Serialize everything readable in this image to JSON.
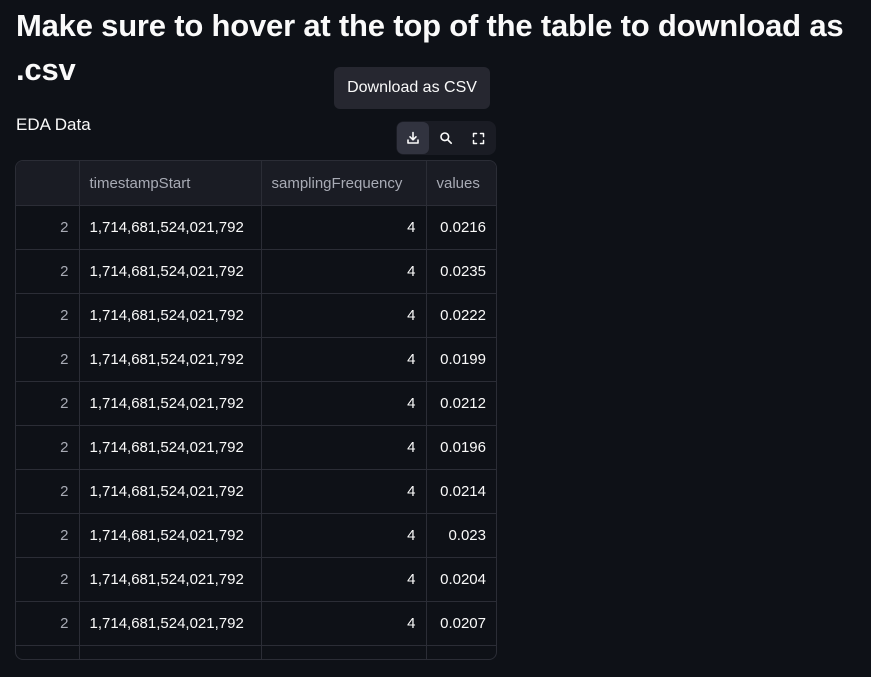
{
  "page": {
    "title": "Make sure to hover at the top of the table to download as .csv",
    "tooltip": "Download as CSV",
    "section_label": "EDA Data"
  },
  "toolbar": {
    "buttons": [
      {
        "icon": "download-icon"
      },
      {
        "icon": "search-icon"
      },
      {
        "icon": "fullscreen-icon"
      }
    ]
  },
  "table": {
    "columns": [
      "",
      "timestampStart",
      "samplingFrequency",
      "values"
    ],
    "rows": [
      {
        "index": "2",
        "timestampStart": "1,714,681,524,021,792",
        "samplingFrequency": "4",
        "values": "0.0216"
      },
      {
        "index": "2",
        "timestampStart": "1,714,681,524,021,792",
        "samplingFrequency": "4",
        "values": "0.0235"
      },
      {
        "index": "2",
        "timestampStart": "1,714,681,524,021,792",
        "samplingFrequency": "4",
        "values": "0.0222"
      },
      {
        "index": "2",
        "timestampStart": "1,714,681,524,021,792",
        "samplingFrequency": "4",
        "values": "0.0199"
      },
      {
        "index": "2",
        "timestampStart": "1,714,681,524,021,792",
        "samplingFrequency": "4",
        "values": "0.0212"
      },
      {
        "index": "2",
        "timestampStart": "1,714,681,524,021,792",
        "samplingFrequency": "4",
        "values": "0.0196"
      },
      {
        "index": "2",
        "timestampStart": "1,714,681,524,021,792",
        "samplingFrequency": "4",
        "values": "0.0214"
      },
      {
        "index": "2",
        "timestampStart": "1,714,681,524,021,792",
        "samplingFrequency": "4",
        "values": "0.023"
      },
      {
        "index": "2",
        "timestampStart": "1,714,681,524,021,792",
        "samplingFrequency": "4",
        "values": "0.0204"
      },
      {
        "index": "2",
        "timestampStart": "1,714,681,524,021,792",
        "samplingFrequency": "4",
        "values": "0.0207"
      }
    ]
  },
  "colors": {
    "background": "#0e1117",
    "surface": "#1a1c24",
    "tooltip": "#262730",
    "border": "#2b2d36",
    "text": "#fafafa",
    "muted_text": "#a8abb5"
  }
}
